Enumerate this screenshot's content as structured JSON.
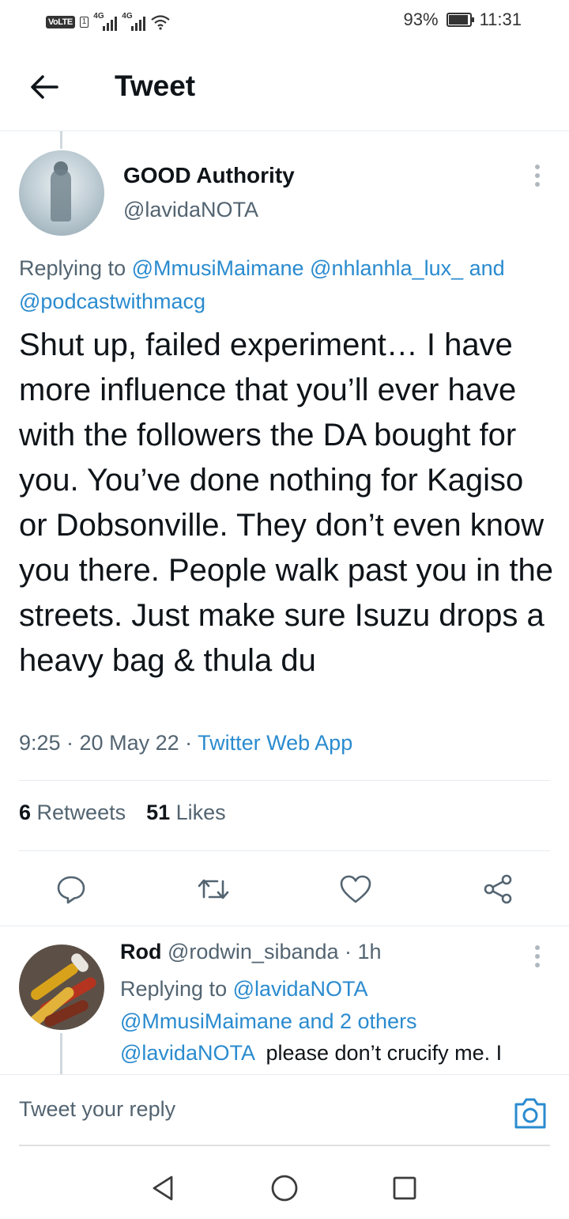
{
  "status_bar": {
    "volte": "VoLTE",
    "sim": "1",
    "net1": "4G",
    "net2": "4G",
    "battery": "93%",
    "battery_level": 0.93,
    "time": "11:31"
  },
  "header": {
    "title": "Tweet",
    "back_icon": "arrow-left-icon"
  },
  "tweet": {
    "author_name": "GOOD Authority",
    "author_handle": "@lavidaNOTA",
    "replying_prefix": "Replying to ",
    "replying_users": "@MmusiMaimane @nhlanhla_lux_",
    "replying_and": " and",
    "replying_more": "@podcastwithmacg",
    "text": "Shut up, failed experiment… I have more influence that you’ll ever have with the followers the DA bought for you. You’ve done nothing for Kagiso or Dobsonville. They don’t even know you there. People walk past you in the streets. Just make sure Isuzu drops a heavy bag & thula du",
    "time_date": "9:25 · 20 May 22 · ",
    "source": "Twitter Web App",
    "retweets_count": "6",
    "retweets_label": " Retweets",
    "likes_count": "51",
    "likes_label": " Likes"
  },
  "actions": {
    "reply_icon": "reply-icon",
    "retweet_icon": "retweet-icon",
    "like_icon": "heart-icon",
    "share_icon": "share-icon"
  },
  "reply": {
    "name": "Rod",
    "handle": " @rodwin_sibanda",
    "time": " · 1h",
    "replying_prefix": "Replying to ",
    "replying_user": "@lavidaNOTA",
    "replying_others": "@MmusiMaimane and 2 others",
    "mention": "@lavidaNOTA",
    "text": "  please don’t crucify me. I"
  },
  "reply_bar": {
    "placeholder": "Tweet your reply",
    "camera_icon": "camera-icon"
  },
  "nav_bar": {
    "back_icon": "nav-back-icon",
    "home_icon": "nav-home-icon",
    "recents_icon": "nav-recents-icon"
  },
  "colors": {
    "link": "#2a8bcf",
    "text": "#0f1419",
    "muted": "#536471",
    "divider": "#e6ecf0"
  }
}
